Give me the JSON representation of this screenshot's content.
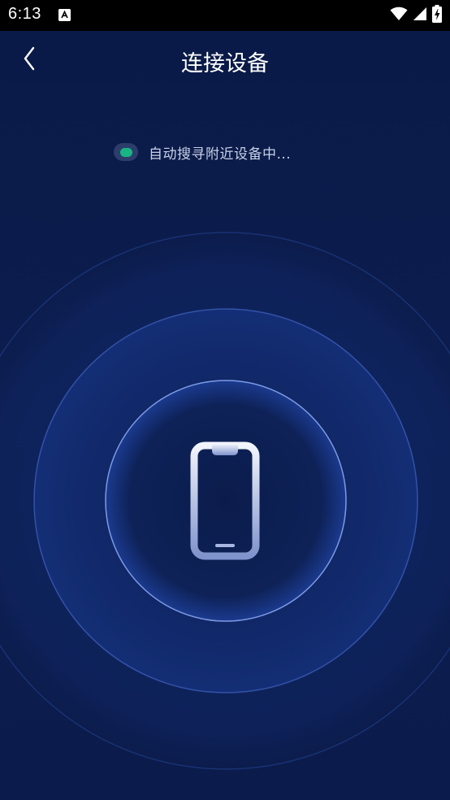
{
  "status_bar": {
    "time": "6:13",
    "notification_icon": "a-box-icon",
    "wifi_icon": "wifi-icon",
    "signal_icon": "signal-icon",
    "battery_icon": "battery-charging-icon"
  },
  "header": {
    "title": "连接设备",
    "back_icon": "chevron-left-icon"
  },
  "search": {
    "status_text": "自动搜寻附近设备中...",
    "indicator_color": "#18b583"
  },
  "radar": {
    "center_icon": "smartphone-icon"
  },
  "colors": {
    "background": "#0b1c4d",
    "ring": "#6f8fe8",
    "accent": "#18b583",
    "title": "#ffffff"
  }
}
